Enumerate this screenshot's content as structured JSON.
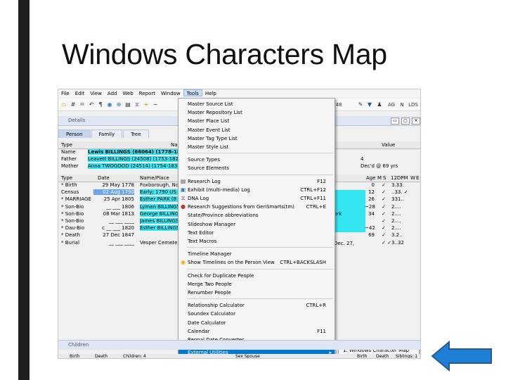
{
  "slide": {
    "title": "Windows Characters Map"
  },
  "menubar": [
    "File",
    "Edit",
    "View",
    "Add",
    "Web",
    "Report",
    "Window",
    "Tools",
    "Help"
  ],
  "toolbar": {
    "right_labels": [
      "AG",
      "N",
      "LDS"
    ],
    "combo": "48"
  },
  "details": {
    "label": "Details"
  },
  "tabs": [
    "Person",
    "Family",
    "Tree"
  ],
  "person_grid": {
    "headers": [
      "Type",
      "Na",
      "Value"
    ],
    "rows": [
      {
        "type": "Name",
        "value": "Lewis BILLINGS (66064)  (1778-18"
      },
      {
        "type": "Father",
        "value": "Leavett BILLINGS (24508)  (1753-182"
      },
      {
        "type": "Mother",
        "value": "Anna TWOGOOD (24514)  (1754-183"
      }
    ],
    "extra_values": [
      "4",
      "Dec'd @ 69 yrs"
    ]
  },
  "events_grid": {
    "headers": [
      "Type",
      "Date",
      "Name/Place",
      "Age",
      "M",
      "S",
      "12DPM",
      "W",
      "E"
    ],
    "rows": [
      {
        "type": "* Birth",
        "date": "29 May 1778",
        "place": "Foxborough, No",
        "age": "0",
        "flags": "✓",
        "dpm": "3.33."
      },
      {
        "type": "Census",
        "date": "02 Aug 1790",
        "place": "Early; 1790 US F",
        "age": "12",
        "flags": "✓",
        "dpm": "..33. ✓"
      },
      {
        "type": "* MARRIAGE",
        "date": "25 Apr 1805",
        "place": "Esther PARK (8",
        "age": "26",
        "flags": "✓",
        "dpm": "331.."
      },
      {
        "type": "* Son-Bio",
        "date": "__ ___ 1806",
        "place": "Lyman BILLINGS",
        "age": "~28",
        "flags": "✓",
        "dpm": "2...."
      },
      {
        "type": "* Son-Bio",
        "date": "08 Mar 1813",
        "place": "George BILLING",
        "age": "34",
        "flags": "✓",
        "dpm": "2...."
      },
      {
        "type": "* Son-Bio",
        "date": "__ ___ ____",
        "place": "James BILLINGS",
        "age": "",
        "flags": "✓",
        "dpm": "2...."
      },
      {
        "type": "* Dau-Bio",
        "date": "c __ ___ 1820",
        "place": "Esther BILLINGS",
        "age": "~42",
        "flags": "✓",
        "dpm": "2...."
      },
      {
        "type": "* Death",
        "date": "27 Dec 1847",
        "place": "",
        "age": "69",
        "flags": "✓",
        "dpm": "3.2.."
      },
      {
        "type": "* Burial",
        "date": "__ ___ ____",
        "place": "Vesper Cemeter",
        "age": "",
        "flags": "✓ ✓",
        "dpm": "3..32"
      }
    ],
    "overlay_texts": [
      "ork",
      "Dec. 27,"
    ]
  },
  "tools_menu": {
    "items": [
      {
        "label": "Master Source List",
        "shortcut": ""
      },
      {
        "label": "Master Repository List",
        "shortcut": ""
      },
      {
        "label": "Master Place List",
        "shortcut": ""
      },
      {
        "label": "Master Event List",
        "shortcut": ""
      },
      {
        "label": "Master Tag Type List",
        "shortcut": ""
      },
      {
        "label": "Master Style List",
        "shortcut": ""
      },
      {
        "label": "Source Types",
        "shortcut": ""
      },
      {
        "label": "Source Elements",
        "shortcut": ""
      },
      {
        "label": "Research Log",
        "shortcut": "F12"
      },
      {
        "label": "Exhibit (multi-media) Log",
        "shortcut": "CTRL+F12"
      },
      {
        "label": "DNA Log",
        "shortcut": "CTRL+F11"
      },
      {
        "label": "Research Suggestions from GenSmarts(tm)",
        "shortcut": "CTRL+E"
      },
      {
        "label": "State/Province abbreviations",
        "shortcut": ""
      },
      {
        "label": "Slideshow Manager",
        "shortcut": ""
      },
      {
        "label": "Text Editor",
        "shortcut": ""
      },
      {
        "label": "Text Macros",
        "shortcut": ""
      },
      {
        "label": "Timeline Manager",
        "shortcut": ""
      },
      {
        "label": "Show Timelines on the Person View",
        "shortcut": "CTRL+BACKSLASH"
      },
      {
        "label": "Check for Duplicate People",
        "shortcut": ""
      },
      {
        "label": "Merge Two People",
        "shortcut": ""
      },
      {
        "label": "Renumber People",
        "shortcut": ""
      },
      {
        "label": "Relationship Calculator",
        "shortcut": "CTRL+R"
      },
      {
        "label": "Soundex Calculator",
        "shortcut": ""
      },
      {
        "label": "Date Calculator",
        "shortcut": ""
      },
      {
        "label": "Calendar",
        "shortcut": "F11"
      },
      {
        "label": "Regnal Date Converter",
        "shortcut": ""
      },
      {
        "label": "External Utilities",
        "shortcut": ""
      }
    ],
    "submenu_item": "1. Windows Character Map"
  },
  "children_pane": {
    "label": "Children",
    "headers": [
      "Birth",
      "Death",
      "Children: 4",
      "Sex Spouse",
      "Birth",
      "Death",
      "Siblings: 1"
    ]
  },
  "colors": {
    "highlight": "#33e6f2",
    "menu_selected": "#0078d7",
    "arrow_fill": "#1e7fd6"
  }
}
